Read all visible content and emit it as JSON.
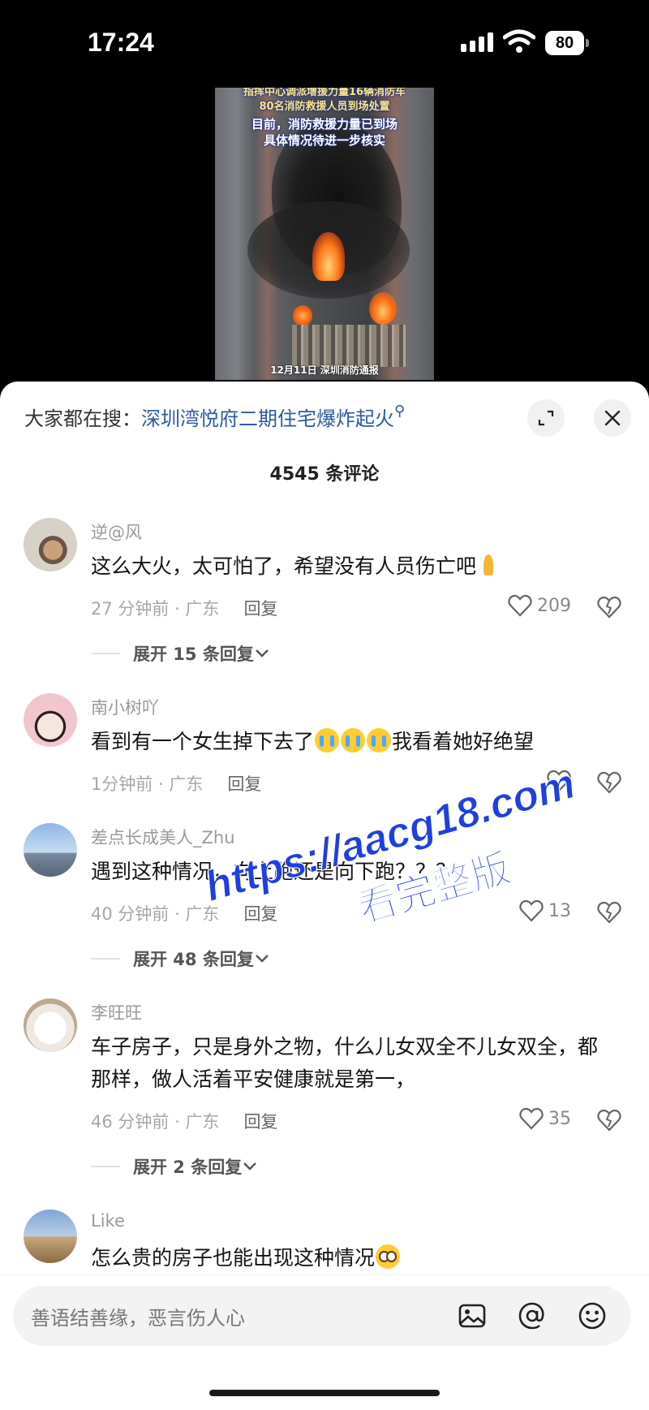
{
  "status_bar": {
    "time": "17:24",
    "battery": "80"
  },
  "video": {
    "caption_lines": [
      "指挥中心调派增援力量16辆消防车",
      "80名消防救援人员到场处置",
      "目前，消防救援力量已到场",
      "具体情况待进一步核实"
    ],
    "date_stamp": "12月11日 深圳消防通报"
  },
  "sheet": {
    "search_label": "大家都在搜：",
    "search_keyword": "深圳湾悦府二期住宅爆炸起火",
    "comment_count": "4545 条评论"
  },
  "comments": [
    {
      "user": "逆@风",
      "text": "这么大火，太可怕了，希望没有人员伤亡吧",
      "time": "27 分钟前 · 广东",
      "reply": "回复",
      "likes": "209",
      "expand": "展开 15 条回复"
    },
    {
      "user": "南小树吖",
      "text_before": "看到有一个女生掉下去了",
      "text_after": "我看着她好绝望",
      "time": "1分钟前 · 广东",
      "reply": "回复"
    },
    {
      "user": "差点长成美人_Zhu",
      "text": "遇到这种情况，向上跑还是向下跑？？？",
      "time": "40 分钟前 · 广东",
      "reply": "回复",
      "likes": "13",
      "expand": "展开 48 条回复"
    },
    {
      "user": "李旺旺",
      "text": "车子房子，只是身外之物，什么儿女双全不儿女双全，都那样，做人活着平安健康就是第一，",
      "time": "46 分钟前 · 广东",
      "reply": "回复",
      "likes": "35",
      "expand": "展开 2 条回复"
    },
    {
      "user": "Like",
      "text": "怎么贵的房子也能出现这种情况"
    }
  ],
  "watermark": {
    "line1": "https://aacg18.com",
    "line2": "看完整版"
  },
  "input": {
    "placeholder": "善语结善缘，恶言伤人心"
  },
  "colors": {
    "keyword": "#2c5aa0",
    "watermark": "#1f3fe0"
  },
  "icons": [
    "signal-icon",
    "wifi-icon",
    "battery-icon",
    "search-icon",
    "expand-icon",
    "close-icon",
    "heart-icon",
    "dislike-icon",
    "chevron-down-icon",
    "image-icon",
    "at-icon",
    "emoji-icon"
  ]
}
